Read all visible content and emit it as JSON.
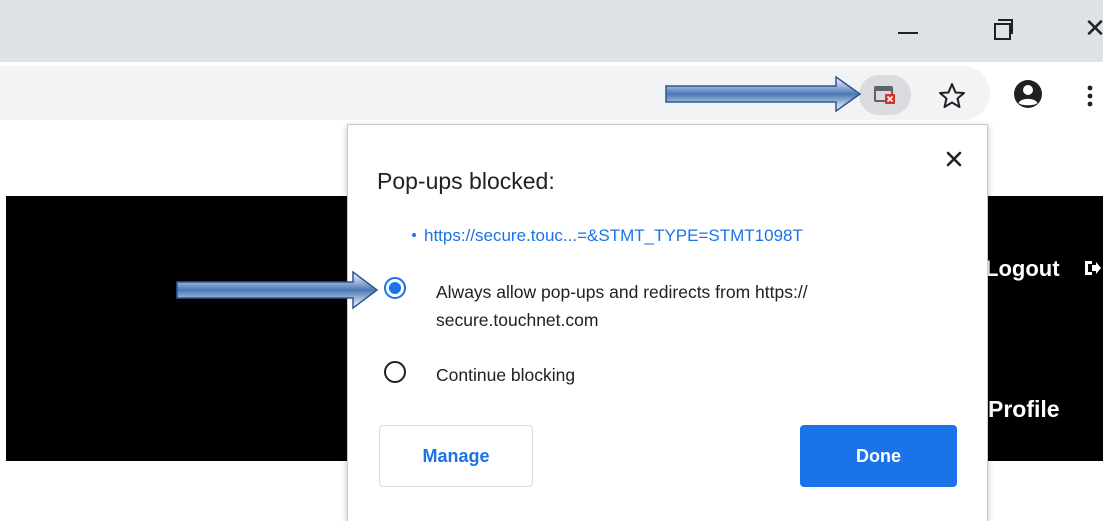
{
  "window": {
    "minimize_glyph": "",
    "close_glyph": "✕"
  },
  "toolbar": {
    "popup_blocked_icon": "popup-blocked-icon",
    "star_icon": "star-icon",
    "account_icon": "account-icon",
    "menu_icon": "three-dot-menu-icon"
  },
  "page": {
    "logout_label": "Logout",
    "profile_label": "Profile"
  },
  "bubble": {
    "title": "Pop-ups blocked:",
    "blocked_url": "https://secure.touc...=&STMT_TYPE=STMT1098T",
    "options": [
      {
        "label": "Always allow pop-ups and redirects from https:// secure.touchnet.com",
        "selected": true
      },
      {
        "label": "Continue blocking",
        "selected": false
      }
    ],
    "manage_label": "Manage",
    "done_label": "Done"
  },
  "colors": {
    "accent": "#1a73e8",
    "titlebar": "#dee1e6",
    "omnibox": "#f1f3f4",
    "header": "#000000",
    "arrow_fill": "#4a78b5"
  }
}
